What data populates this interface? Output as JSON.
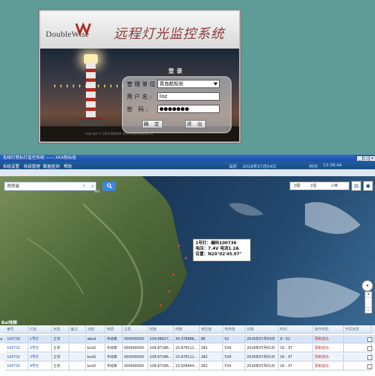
{
  "login": {
    "logo_text": "DoubleWise",
    "title": "远程灯光监控系统",
    "panel_title": "登录",
    "unit_label": "管理单位:",
    "unit_value": "青岛航标处",
    "user_label": "用户名:",
    "user_value": "lisz",
    "password_label": "密 码:",
    "password_value": "●●●●●●●",
    "ok_label": "确 定",
    "exit_label": "退 出",
    "copyright": "Copyright © 2010 版权所有 深圳市成都科技有限公司"
  },
  "app": {
    "title": "无线灯塔标灯监控系统 —— XXX航标处",
    "menu": [
      "系统设置",
      "系统管理",
      "数据查询",
      "帮助"
    ],
    "status": [
      "当前",
      "2016年07月04日",
      "时间",
      "13:38:44"
    ]
  },
  "map": {
    "search_value": "南南省",
    "search_clear": "×",
    "search_nav": "↗",
    "search_button_icon": "search-icon",
    "route_label": "路线",
    "map_types": [
      "卫图",
      "卫星",
      "三维"
    ],
    "compass_icon": "compass-icon",
    "zoom_plus": "+",
    "zoom_minus": "−",
    "logo": "Bai地图",
    "popup": {
      "line1": "1号灯：编码100736",
      "line2": "电压：7.4V  电流1.2A",
      "line3": "位置：N20°02'45.97\""
    }
  },
  "table": {
    "columns": [
      "编号",
      "灯名",
      "状态",
      "备注",
      "功能",
      "电源",
      "主机",
      "经度",
      "纬度",
      "电压值",
      "电流值",
      "日期",
      "时间",
      "操作状态",
      "开关状态"
    ],
    "rows": [
      [
        "100736",
        "1号灯",
        "正常",
        "",
        "abcd",
        "半动率",
        "000000000",
        "109.88027...",
        "34.378986...",
        "86",
        "52",
        "2016年07月03日",
        "9 : 52",
        "更新成功",
        ""
      ],
      [
        "100732",
        "2号灯",
        "正常",
        "",
        "bcd2",
        "半动率",
        "000000000",
        "108.87186...",
        "23.878111...",
        "282",
        "534",
        "2016年07月01日",
        "16 : 37",
        "更新成功",
        ""
      ],
      [
        "100732",
        "3号灯",
        "正常",
        "",
        "bcd2",
        "半动率",
        "000000000",
        "108.87186...",
        "23.878111...",
        "282",
        "534",
        "2016年07月01日",
        "16 : 37",
        "更新成功",
        ""
      ],
      [
        "100731",
        "4号灯",
        "正常",
        "",
        "bcd2",
        "半动率",
        "000000000",
        "108.87186...",
        "23.508444...",
        "282",
        "534",
        "2016年07月01日",
        "16 : 37",
        "更新成功",
        ""
      ]
    ],
    "current_marker": "▸"
  },
  "colors": {
    "desktop_bg": "#5f9b97",
    "titlebar": "#2f68c6",
    "menubar": "#215f9f",
    "accent_red": "#b82a1f",
    "accent_blue": "#1b4ea8"
  }
}
